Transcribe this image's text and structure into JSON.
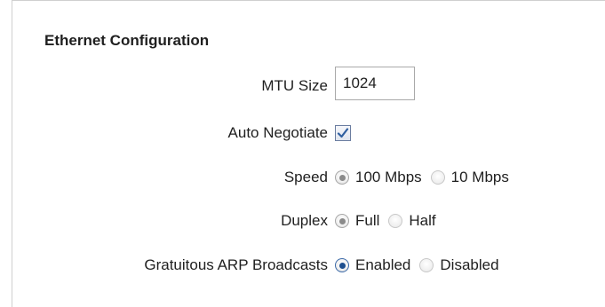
{
  "section": {
    "title": "Ethernet Configuration"
  },
  "mtu": {
    "label": "MTU Size",
    "value": "1024"
  },
  "auto_negotiate": {
    "label": "Auto Negotiate",
    "checked": true
  },
  "speed": {
    "label": "Speed",
    "options": [
      {
        "label": "100 Mbps",
        "selected": true
      },
      {
        "label": "10 Mbps",
        "selected": false
      }
    ]
  },
  "duplex": {
    "label": "Duplex",
    "options": [
      {
        "label": "Full",
        "selected": true
      },
      {
        "label": "Half",
        "selected": false
      }
    ]
  },
  "arp": {
    "label": "Gratuitous ARP Broadcasts",
    "options": [
      {
        "label": "Enabled",
        "selected": true
      },
      {
        "label": "Disabled",
        "selected": false
      }
    ]
  },
  "colors": {
    "checkbox_check": "#2f5fa0",
    "radio_selected_active": "#1e4f8f",
    "radio_selected_disabled": "#8a8a8a"
  }
}
